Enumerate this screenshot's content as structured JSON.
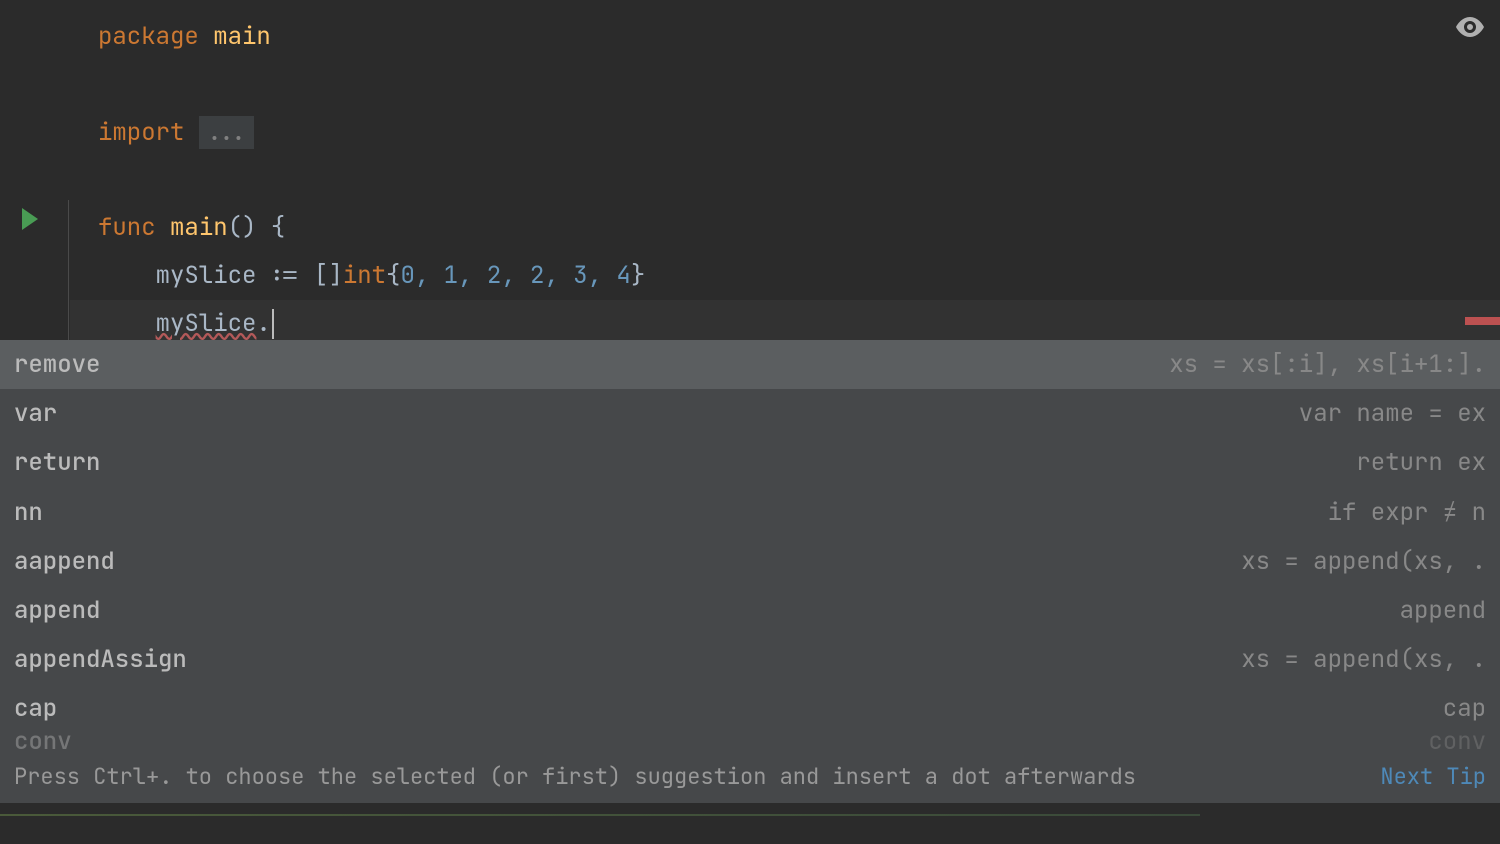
{
  "code": {
    "line1": {
      "keyword": "package",
      "identifier": "main"
    },
    "line3": {
      "keyword": "import",
      "folded": "..."
    },
    "line5": {
      "keyword": "func",
      "funcname": "main",
      "parens": "() {",
      "after": ""
    },
    "line6": {
      "indent": "    ",
      "var": "mySlice",
      "op": " := []",
      "type": "int",
      "brace_open": "{",
      "values": "0, 1, 2, 2, 3, 4",
      "brace_close": "}"
    },
    "line7": {
      "indent": "    ",
      "var": "mySlice",
      "dot": "."
    }
  },
  "completions": [
    {
      "label": "remove",
      "hint": "xs = xs[:i], xs[i+1:]."
    },
    {
      "label": "var",
      "hint": "var name = ex"
    },
    {
      "label": "return",
      "hint": "return ex"
    },
    {
      "label": "nn",
      "hint": "if expr ≠ n"
    },
    {
      "label": "aappend",
      "hint": "xs = append(xs, ."
    },
    {
      "label": "append",
      "hint": "append"
    },
    {
      "label": "appendAssign",
      "hint": "xs = append(xs, ."
    },
    {
      "label": "cap",
      "hint": "cap"
    },
    {
      "label": "conv",
      "hint": "conv"
    }
  ],
  "footer": {
    "hint": "Press Ctrl+. to choose the selected (or first) suggestion and insert a dot afterwards",
    "link": "Next Tip"
  }
}
